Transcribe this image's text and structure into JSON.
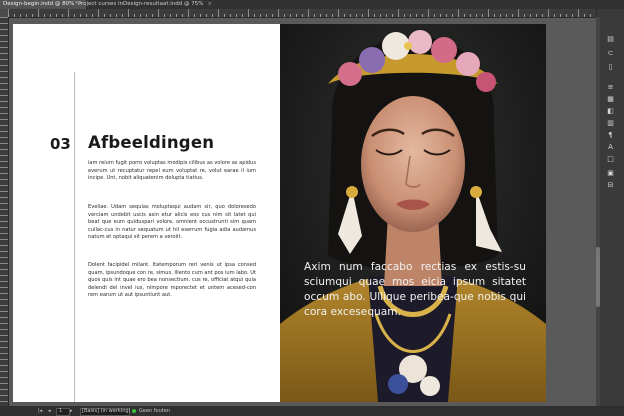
{
  "tabs": [
    {
      "label": "Design-begin.indd @ 80%",
      "close": "×"
    },
    {
      "label": "*Project curses InDesign-resultaat.indd @ 75%",
      "close": "×"
    }
  ],
  "layout": {
    "number": "03",
    "heading": "Afbeeldingen",
    "paragraphs": [
      "iam reium fugit porro voluptas modipis cilibus as volore as apidus everum ut recuptatur repel eum voluptat re, volut earae il ium incipe. Unt, nobit aliquatenim dolupta tiatius.",
      "Evellae. Udam sequias moluptaqui audam sir, quo doloresedo verciam undebit uscis asin etur alicis eos cus nim sit latet qui beat que eum quiduspari volore, omnient occustrunti sim quam cullac-cus in natur sequatum ut hil eserrum fugia adia audamus natum et optaqui sit perem a veroiit.",
      "Dolent facipidel milant. Itatemporum reri venis ut ipsa consed quam, ipsundoque con re, simus. Illento cum ant pos ium labo. Ut quos quis int quae ero bea nonsectium, cus re, officiat atqui quia delendi del invel ius, nimpore mporectet et untem acesed-con rem earum ut aut ipsuntiunt aut."
    ],
    "overlay_text": "Axim num faccabo rectias ex estis-su sciumqui quae mos eicia ipsum sitatet occum abo. Ullique peribea-que nobis qui cora excesequam."
  },
  "status": {
    "page_field": "1",
    "style_field": "[Basis] (in werking)",
    "preflight": "Geen fouten"
  },
  "colors": {
    "accent_ok": "#3bbf3b",
    "pasteboard": "#5a5a5a",
    "chrome": "#323232"
  },
  "toolbar_icons": [
    "layers-icon",
    "links-icon",
    "pages-icon",
    "stroke-icon",
    "swatches-icon",
    "color-icon",
    "gradient-icon",
    "paragraph-styles-icon",
    "character-styles-icon",
    "object-styles-icon",
    "text-wrap-icon",
    "align-icon"
  ]
}
